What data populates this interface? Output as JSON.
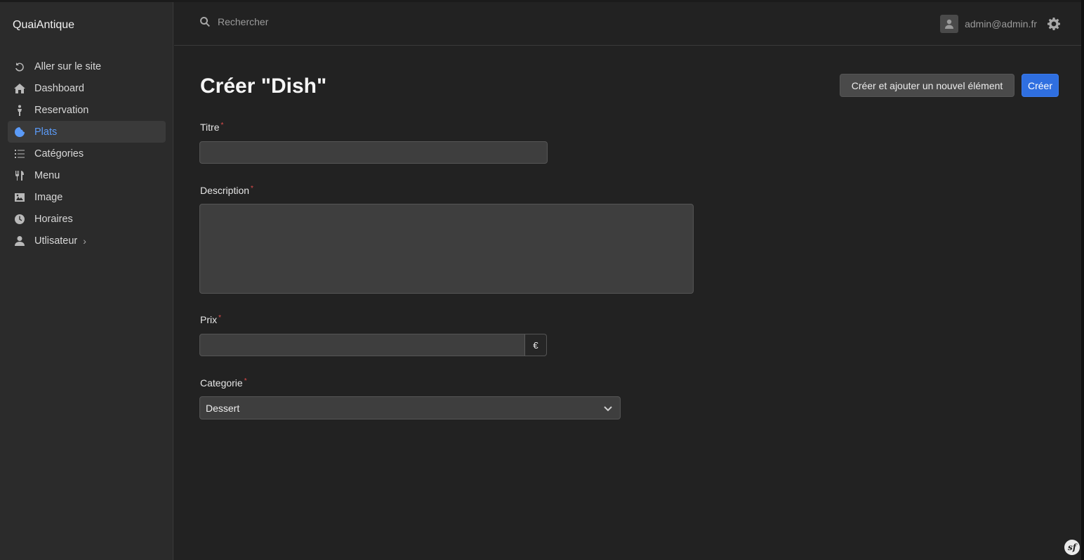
{
  "app": {
    "brand": "QuaiAntique"
  },
  "sidebar": {
    "items": [
      {
        "label": "Aller sur le site",
        "icon": "undo-icon"
      },
      {
        "label": "Dashboard",
        "icon": "home-icon"
      },
      {
        "label": "Reservation",
        "icon": "person-icon"
      },
      {
        "label": "Plats",
        "icon": "cookie-icon",
        "active": true
      },
      {
        "label": "Catégories",
        "icon": "list-icon"
      },
      {
        "label": "Menu",
        "icon": "utensils-icon"
      },
      {
        "label": "Image",
        "icon": "image-icon"
      },
      {
        "label": "Horaires",
        "icon": "clock-icon"
      },
      {
        "label": "Utlisateur",
        "icon": "user-icon",
        "has_submenu": true
      }
    ]
  },
  "header": {
    "search_placeholder": "Rechercher",
    "user_email": "admin@admin.fr"
  },
  "page": {
    "title": "Créer \"Dish\"",
    "btn_save_and_add": "Créer et ajouter un nouvel élément",
    "btn_create": "Créer"
  },
  "form": {
    "titre": {
      "label": "Titre",
      "required_mark": "*",
      "value": ""
    },
    "description": {
      "label": "Description",
      "required_mark": "*",
      "value": ""
    },
    "prix": {
      "label": "Prix",
      "required_mark": "*",
      "value": "",
      "currency": "€"
    },
    "categorie": {
      "label": "Categorie",
      "required_mark": "*",
      "selected": "Dessert"
    }
  },
  "colors": {
    "accent": "#2f6fe0",
    "active_menu": "#5b9bf8",
    "required": "#e14b4b",
    "background": "#222222",
    "sidebar": "#2b2b2b"
  },
  "footer": {
    "logo_text": "sf"
  }
}
